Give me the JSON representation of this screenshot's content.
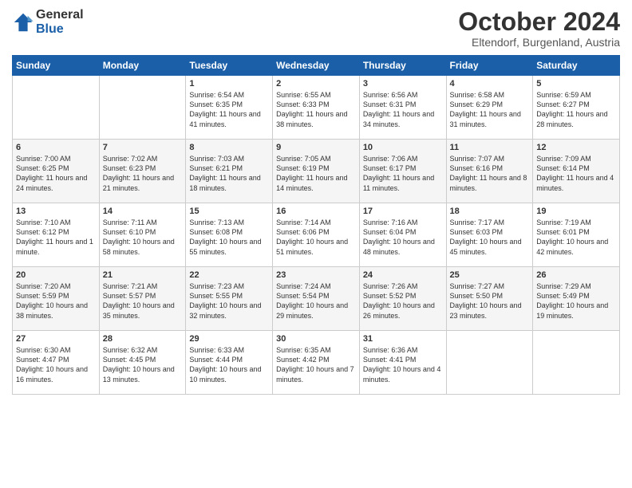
{
  "logo": {
    "general": "General",
    "blue": "Blue"
  },
  "title": "October 2024",
  "subtitle": "Eltendorf, Burgenland, Austria",
  "days_header": [
    "Sunday",
    "Monday",
    "Tuesday",
    "Wednesday",
    "Thursday",
    "Friday",
    "Saturday"
  ],
  "weeks": [
    [
      {
        "day": "",
        "info": ""
      },
      {
        "day": "",
        "info": ""
      },
      {
        "day": "1",
        "info": "Sunrise: 6:54 AM\nSunset: 6:35 PM\nDaylight: 11 hours and 41 minutes."
      },
      {
        "day": "2",
        "info": "Sunrise: 6:55 AM\nSunset: 6:33 PM\nDaylight: 11 hours and 38 minutes."
      },
      {
        "day": "3",
        "info": "Sunrise: 6:56 AM\nSunset: 6:31 PM\nDaylight: 11 hours and 34 minutes."
      },
      {
        "day": "4",
        "info": "Sunrise: 6:58 AM\nSunset: 6:29 PM\nDaylight: 11 hours and 31 minutes."
      },
      {
        "day": "5",
        "info": "Sunrise: 6:59 AM\nSunset: 6:27 PM\nDaylight: 11 hours and 28 minutes."
      }
    ],
    [
      {
        "day": "6",
        "info": "Sunrise: 7:00 AM\nSunset: 6:25 PM\nDaylight: 11 hours and 24 minutes."
      },
      {
        "day": "7",
        "info": "Sunrise: 7:02 AM\nSunset: 6:23 PM\nDaylight: 11 hours and 21 minutes."
      },
      {
        "day": "8",
        "info": "Sunrise: 7:03 AM\nSunset: 6:21 PM\nDaylight: 11 hours and 18 minutes."
      },
      {
        "day": "9",
        "info": "Sunrise: 7:05 AM\nSunset: 6:19 PM\nDaylight: 11 hours and 14 minutes."
      },
      {
        "day": "10",
        "info": "Sunrise: 7:06 AM\nSunset: 6:17 PM\nDaylight: 11 hours and 11 minutes."
      },
      {
        "day": "11",
        "info": "Sunrise: 7:07 AM\nSunset: 6:16 PM\nDaylight: 11 hours and 8 minutes."
      },
      {
        "day": "12",
        "info": "Sunrise: 7:09 AM\nSunset: 6:14 PM\nDaylight: 11 hours and 4 minutes."
      }
    ],
    [
      {
        "day": "13",
        "info": "Sunrise: 7:10 AM\nSunset: 6:12 PM\nDaylight: 11 hours and 1 minute."
      },
      {
        "day": "14",
        "info": "Sunrise: 7:11 AM\nSunset: 6:10 PM\nDaylight: 10 hours and 58 minutes."
      },
      {
        "day": "15",
        "info": "Sunrise: 7:13 AM\nSunset: 6:08 PM\nDaylight: 10 hours and 55 minutes."
      },
      {
        "day": "16",
        "info": "Sunrise: 7:14 AM\nSunset: 6:06 PM\nDaylight: 10 hours and 51 minutes."
      },
      {
        "day": "17",
        "info": "Sunrise: 7:16 AM\nSunset: 6:04 PM\nDaylight: 10 hours and 48 minutes."
      },
      {
        "day": "18",
        "info": "Sunrise: 7:17 AM\nSunset: 6:03 PM\nDaylight: 10 hours and 45 minutes."
      },
      {
        "day": "19",
        "info": "Sunrise: 7:19 AM\nSunset: 6:01 PM\nDaylight: 10 hours and 42 minutes."
      }
    ],
    [
      {
        "day": "20",
        "info": "Sunrise: 7:20 AM\nSunset: 5:59 PM\nDaylight: 10 hours and 38 minutes."
      },
      {
        "day": "21",
        "info": "Sunrise: 7:21 AM\nSunset: 5:57 PM\nDaylight: 10 hours and 35 minutes."
      },
      {
        "day": "22",
        "info": "Sunrise: 7:23 AM\nSunset: 5:55 PM\nDaylight: 10 hours and 32 minutes."
      },
      {
        "day": "23",
        "info": "Sunrise: 7:24 AM\nSunset: 5:54 PM\nDaylight: 10 hours and 29 minutes."
      },
      {
        "day": "24",
        "info": "Sunrise: 7:26 AM\nSunset: 5:52 PM\nDaylight: 10 hours and 26 minutes."
      },
      {
        "day": "25",
        "info": "Sunrise: 7:27 AM\nSunset: 5:50 PM\nDaylight: 10 hours and 23 minutes."
      },
      {
        "day": "26",
        "info": "Sunrise: 7:29 AM\nSunset: 5:49 PM\nDaylight: 10 hours and 19 minutes."
      }
    ],
    [
      {
        "day": "27",
        "info": "Sunrise: 6:30 AM\nSunset: 4:47 PM\nDaylight: 10 hours and 16 minutes."
      },
      {
        "day": "28",
        "info": "Sunrise: 6:32 AM\nSunset: 4:45 PM\nDaylight: 10 hours and 13 minutes."
      },
      {
        "day": "29",
        "info": "Sunrise: 6:33 AM\nSunset: 4:44 PM\nDaylight: 10 hours and 10 minutes."
      },
      {
        "day": "30",
        "info": "Sunrise: 6:35 AM\nSunset: 4:42 PM\nDaylight: 10 hours and 7 minutes."
      },
      {
        "day": "31",
        "info": "Sunrise: 6:36 AM\nSunset: 4:41 PM\nDaylight: 10 hours and 4 minutes."
      },
      {
        "day": "",
        "info": ""
      },
      {
        "day": "",
        "info": ""
      }
    ]
  ]
}
